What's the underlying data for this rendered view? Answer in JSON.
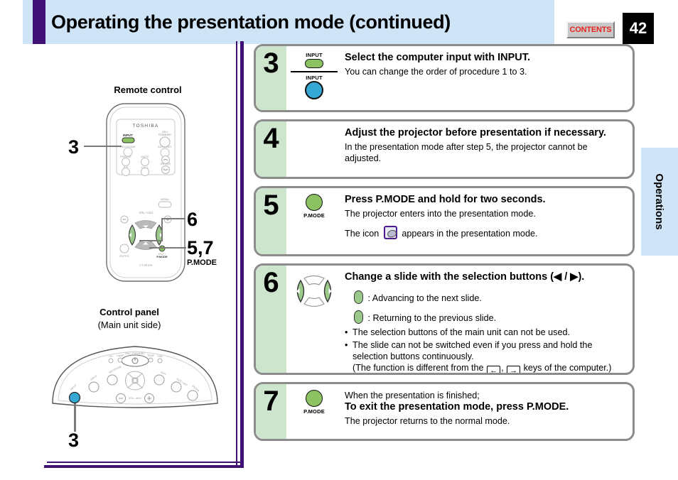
{
  "header": {
    "title": "Operating the presentation mode (continued)",
    "contents_label": "CONTENTS",
    "page_number": "42",
    "accent_color": "#3f1176",
    "band_color": "#cfe4f7"
  },
  "side_tab": {
    "label": "Operations"
  },
  "left_panel": {
    "remote": {
      "title": "Remote control",
      "brand": "TOSHIBA",
      "model": "CT-90106",
      "callouts": [
        {
          "num": "3",
          "target": "INPUT button"
        },
        {
          "num": "6",
          "target": "selection buttons"
        },
        {
          "num": "5,7",
          "sub": "P.MODE",
          "target": "P.MODE button"
        }
      ],
      "button_labels": [
        "INPUT",
        "ON / STANDBY",
        "KEYSTONE",
        "AUTO SET",
        "FREEZE",
        "MUTE",
        "RESIZE",
        "P IP",
        "CALL",
        "MENU",
        "VOL / ADJ",
        "ENTER",
        "EXIT / P.MODE"
      ]
    },
    "control_panel": {
      "title": "Control panel",
      "subtitle": "(Main unit side)",
      "callouts": [
        {
          "num": "3",
          "target": "INPUT button"
        }
      ],
      "button_labels": [
        "ON",
        "LAMP",
        "ON / STANDBY",
        "TEMP",
        "FAN",
        "INPUT",
        "KEYSTONE",
        "EXIT",
        "AUTO SET",
        "ENTER",
        "MENU",
        "VOL / ADJ"
      ]
    }
  },
  "steps": [
    {
      "number": "3",
      "icons": [
        {
          "name": "input-pill-button",
          "label": "INPUT",
          "shape": "pill",
          "color": "#8cc262"
        },
        {
          "name": "input-round-button",
          "label": "INPUT",
          "shape": "circle",
          "color": "#35a8d6"
        }
      ],
      "heading": "Select the computer input with INPUT.",
      "text": "You can change the order of procedure 1 to 3."
    },
    {
      "number": "4",
      "icons": [],
      "heading": "Adjust the projector before presentation if necessary.",
      "text": "In the presentation mode after step 5, the projector cannot be adjusted."
    },
    {
      "number": "5",
      "icons": [
        {
          "name": "pmode-button",
          "label": "P.MODE",
          "shape": "circle",
          "color": "#8cc262"
        }
      ],
      "heading": "Press P.MODE and hold for two seconds.",
      "text": "The projector enters into the presentation mode.",
      "text2_before": "The icon",
      "text2_after": "appears in the presentation mode."
    },
    {
      "number": "6",
      "icons": [
        {
          "name": "selection-pad",
          "label": "",
          "shape": "dpad",
          "color": "#9bc98c"
        }
      ],
      "heading": "Change a slide with the selection buttons (◀ / ▶).",
      "line_next": ": Advancing to the next slide.",
      "line_prev": ": Returning to the previous slide.",
      "bullets": [
        "The selection buttons of the main unit can not be used.",
        "The slide can not be switched even if you press and hold the selection buttons continuously."
      ],
      "note_before": "(The function is different from the",
      "key_left": "←",
      "key_sep": ",",
      "key_right": "→",
      "note_after": "keys of the computer.)"
    },
    {
      "number": "7",
      "icons": [
        {
          "name": "pmode-button",
          "label": "P.MODE",
          "shape": "circle",
          "color": "#8cc262"
        }
      ],
      "text_pre": "When the presentation is finished;",
      "heading": "To exit the presentation mode, press P.MODE.",
      "text": "The projector returns to the normal mode."
    }
  ]
}
